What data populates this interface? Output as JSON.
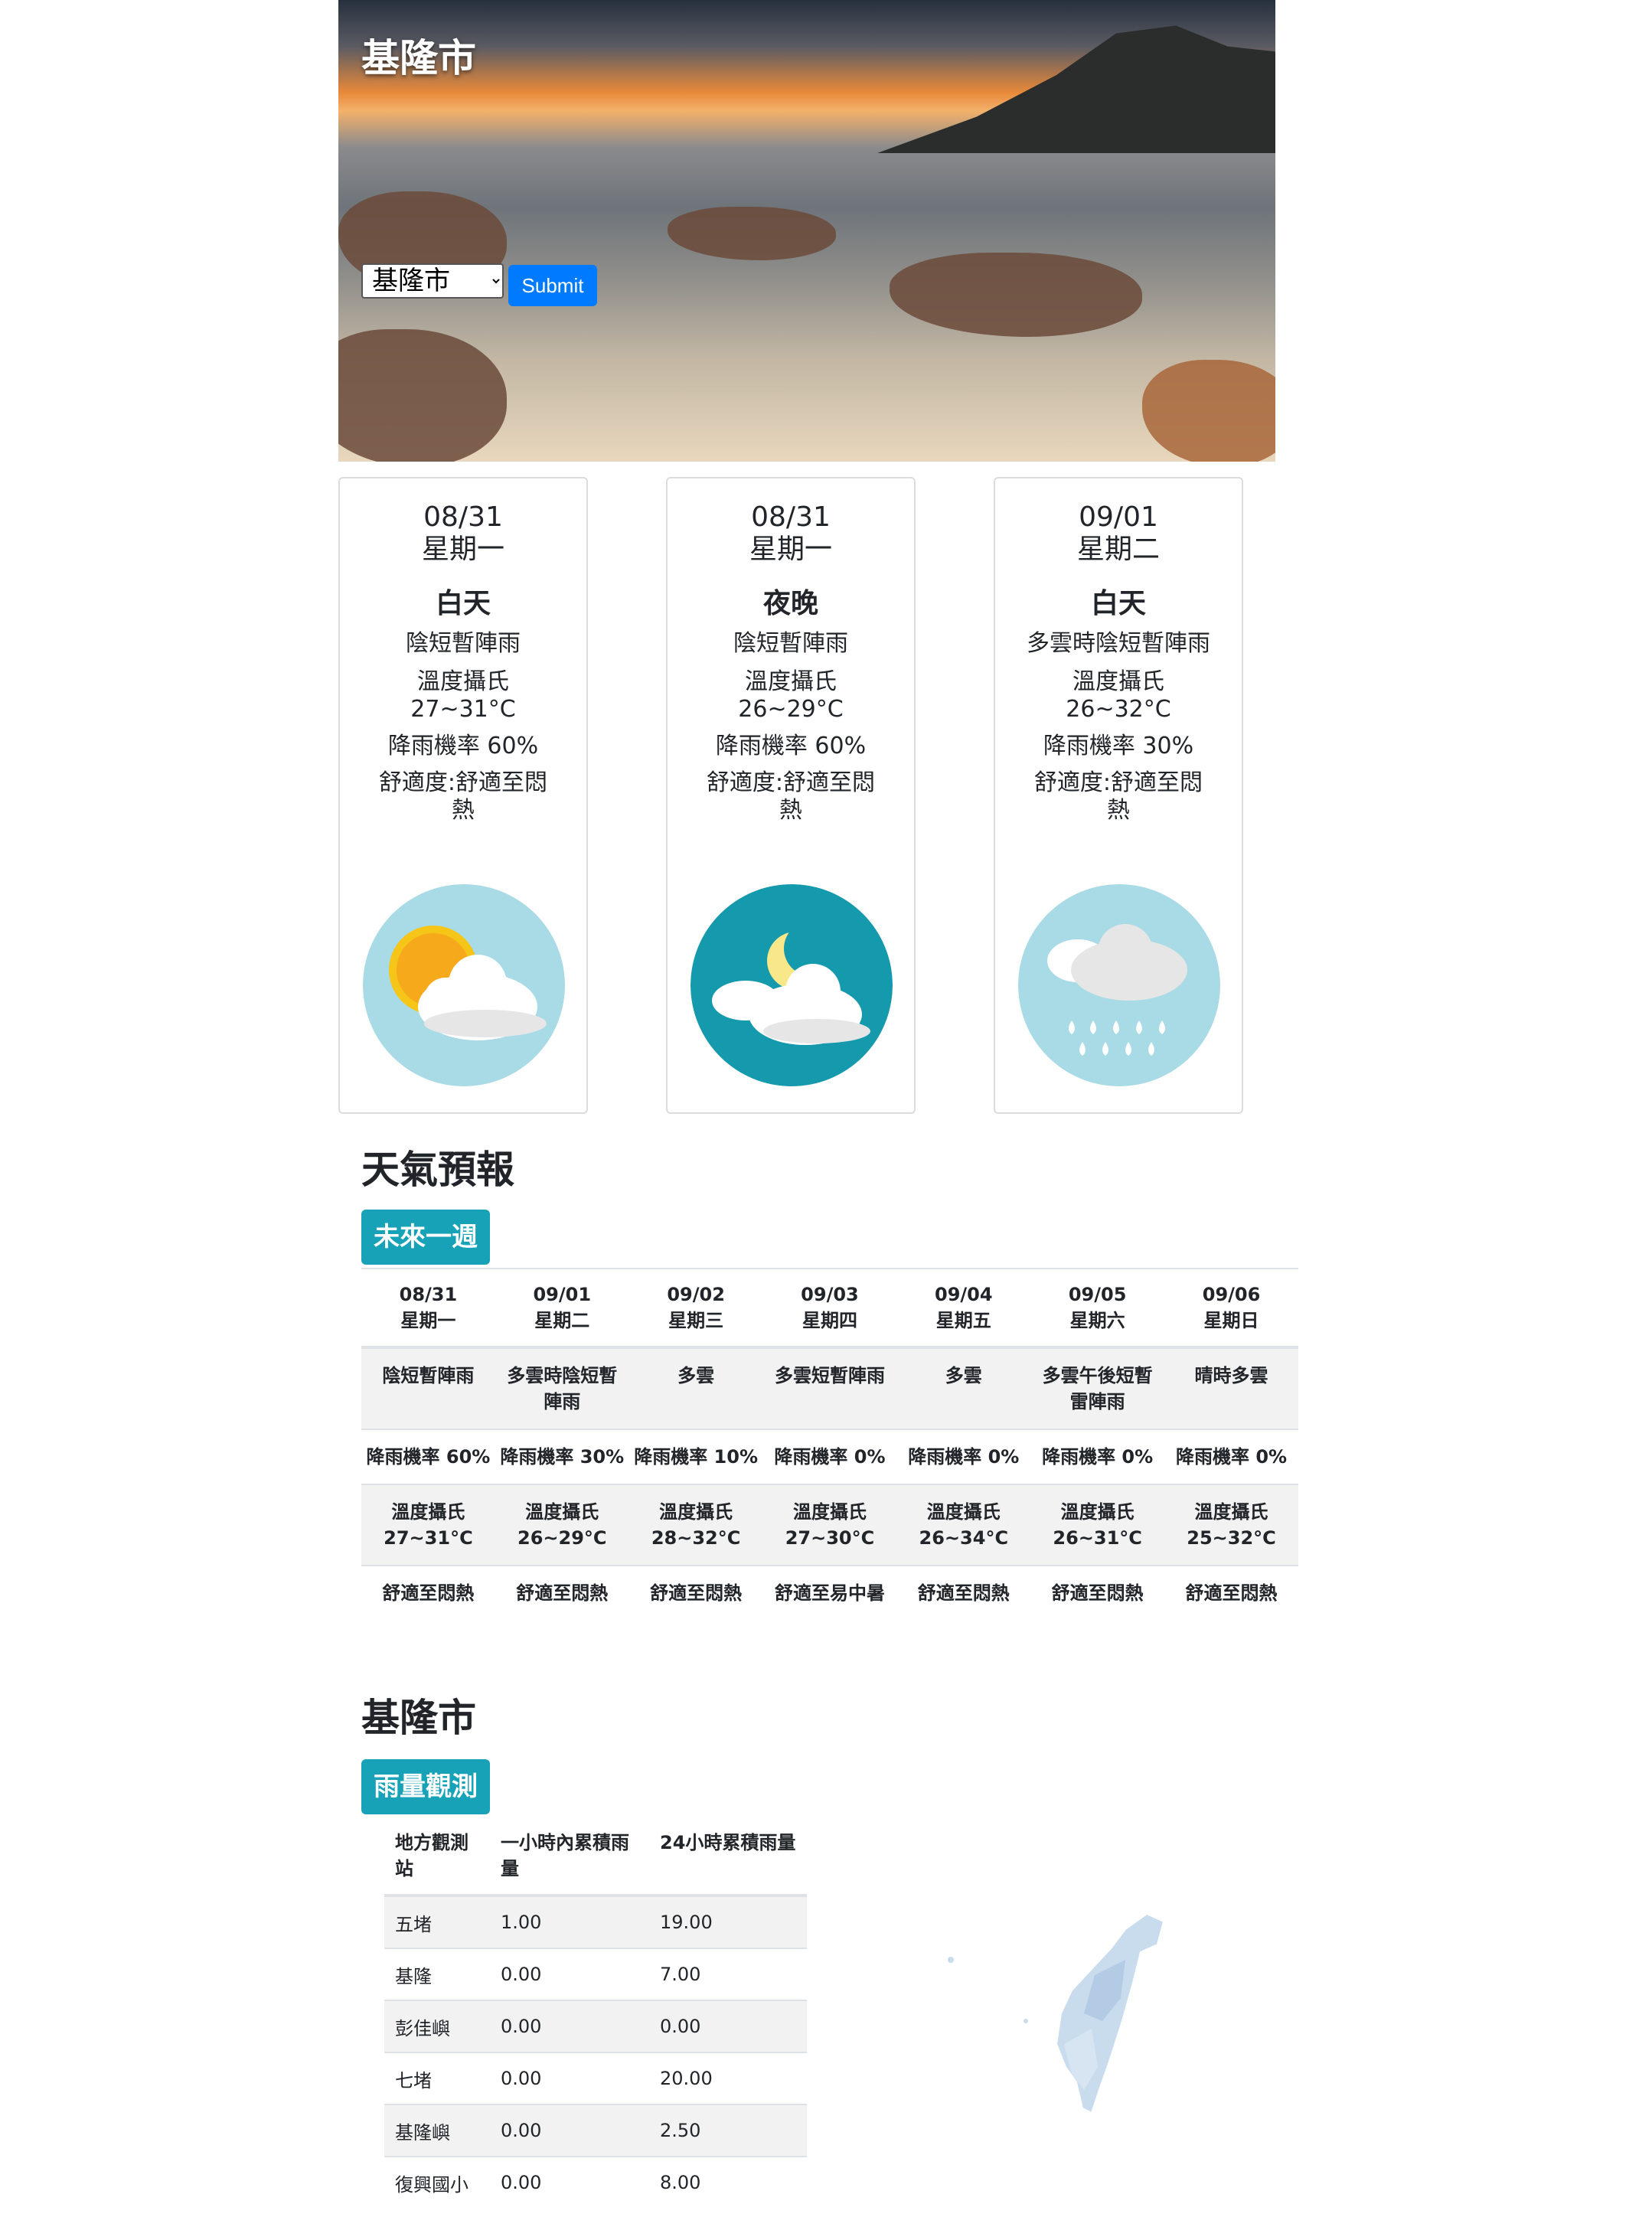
{
  "hero": {
    "title": "基隆市",
    "selected_city": "基隆市",
    "submit_label": "Submit"
  },
  "cards": [
    {
      "date": "08/31",
      "weekday": "星期一",
      "period": "白天",
      "description": "陰短暫陣雨",
      "temp_label": "溫度攝氏",
      "temp_range": "27~31°C",
      "pop": "降雨機率 60%",
      "comfort": "舒適度:舒適至悶熱",
      "icon": "partly-cloudy-day-icon"
    },
    {
      "date": "08/31",
      "weekday": "星期一",
      "period": "夜晚",
      "description": "陰短暫陣雨",
      "temp_label": "溫度攝氏",
      "temp_range": "26~29°C",
      "pop": "降雨機率 60%",
      "comfort": "舒適度:舒適至悶熱",
      "icon": "partly-cloudy-night-icon"
    },
    {
      "date": "09/01",
      "weekday": "星期二",
      "period": "白天",
      "description": "多雲時陰短暫陣雨",
      "temp_label": "溫度攝氏",
      "temp_range": "26~32°C",
      "pop": "降雨機率 30%",
      "comfort": "舒適度:舒適至悶熱",
      "icon": "rain-cloud-icon"
    }
  ],
  "forecast": {
    "title": "天氣預報",
    "badge": "未來一週",
    "days": [
      {
        "date": "08/31",
        "weekday": "星期一",
        "weather": "陰短暫陣雨",
        "pop": "降雨機率 60%",
        "temp": "溫度攝氏 27~31°C",
        "comfort": "舒適至悶熱"
      },
      {
        "date": "09/01",
        "weekday": "星期二",
        "weather": "多雲時陰短暫陣雨",
        "pop": "降雨機率 30%",
        "temp": "溫度攝氏 26~29°C",
        "comfort": "舒適至悶熱"
      },
      {
        "date": "09/02",
        "weekday": "星期三",
        "weather": "多雲",
        "pop": "降雨機率 10%",
        "temp": "溫度攝氏 28~32°C",
        "comfort": "舒適至悶熱"
      },
      {
        "date": "09/03",
        "weekday": "星期四",
        "weather": "多雲短暫陣雨",
        "pop": "降雨機率 0%",
        "temp": "溫度攝氏 27~30°C",
        "comfort": "舒適至易中暑"
      },
      {
        "date": "09/04",
        "weekday": "星期五",
        "weather": "多雲",
        "pop": "降雨機率 0%",
        "temp": "溫度攝氏 26~34°C",
        "comfort": "舒適至悶熱"
      },
      {
        "date": "09/05",
        "weekday": "星期六",
        "weather": "多雲午後短暫雷陣雨",
        "pop": "降雨機率 0%",
        "temp": "溫度攝氏 26~31°C",
        "comfort": "舒適至悶熱"
      },
      {
        "date": "09/06",
        "weekday": "星期日",
        "weather": "晴時多雲",
        "pop": "降雨機率 0%",
        "temp": "溫度攝氏 25~32°C",
        "comfort": "舒適至悶熱"
      }
    ]
  },
  "rain": {
    "title": "基隆市",
    "badge": "雨量觀測",
    "headers": [
      "地方觀測站",
      "一小時內累積雨量",
      "24小時累積雨量"
    ],
    "rows": [
      [
        "五堵",
        "1.00",
        "19.00"
      ],
      [
        "基隆",
        "0.00",
        "7.00"
      ],
      [
        "彭佳嶼",
        "0.00",
        "0.00"
      ],
      [
        "七堵",
        "0.00",
        "20.00"
      ],
      [
        "基隆嶼",
        "0.00",
        "2.50"
      ],
      [
        "復興國小",
        "0.00",
        "8.00"
      ]
    ]
  }
}
